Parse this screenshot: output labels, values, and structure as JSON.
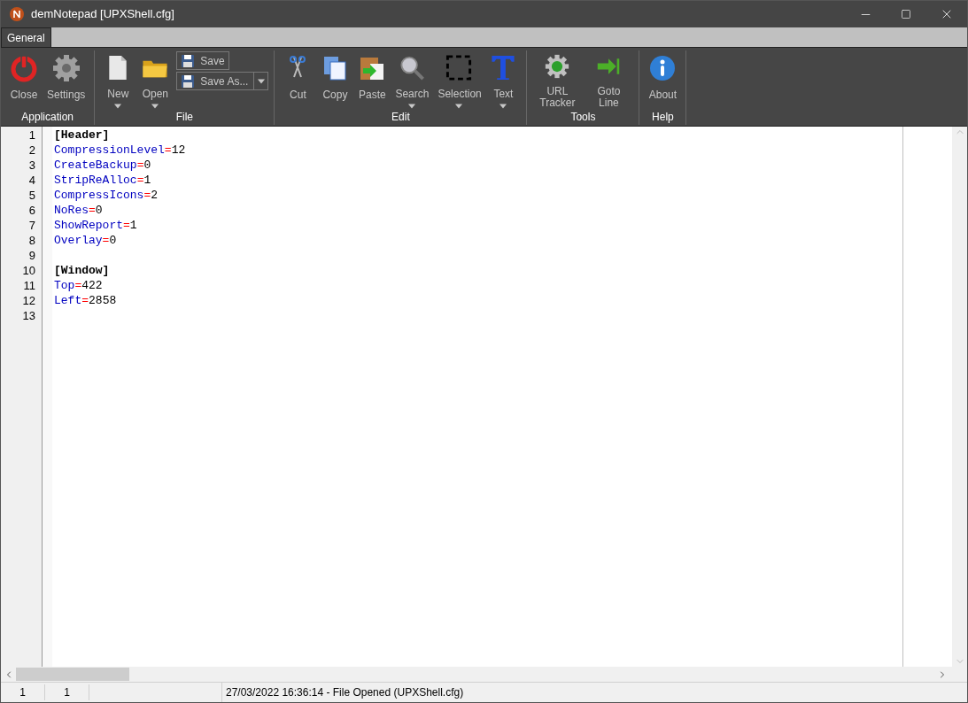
{
  "window": {
    "title": "demNotepad [UPXShell.cfg]"
  },
  "tabs": [
    {
      "label": "General",
      "selected": true
    }
  ],
  "ribbon_groups": [
    {
      "label": "Application",
      "buttons": [
        {
          "label": "Close",
          "kind": "large",
          "has_menu": false
        },
        {
          "label": "Settings",
          "kind": "large",
          "has_menu": false
        }
      ]
    },
    {
      "label": "File",
      "buttons": [
        {
          "label": "New",
          "kind": "large",
          "has_menu": true
        },
        {
          "label": "Open",
          "kind": "large",
          "has_menu": true
        },
        {
          "label": "Save",
          "kind": "small",
          "has_menu": false
        },
        {
          "label": "Save As...",
          "kind": "small",
          "has_menu": true
        }
      ]
    },
    {
      "label": "Edit",
      "buttons": [
        {
          "label": "Cut",
          "kind": "large",
          "has_menu": false
        },
        {
          "label": "Copy",
          "kind": "large",
          "has_menu": false
        },
        {
          "label": "Paste",
          "kind": "large",
          "has_menu": false
        },
        {
          "label": "Search",
          "kind": "large",
          "has_menu": true
        },
        {
          "label": "Selection",
          "kind": "large",
          "has_menu": true
        },
        {
          "label": "Text",
          "kind": "large",
          "has_menu": true
        }
      ]
    },
    {
      "label": "Tools",
      "buttons": [
        {
          "label": "URL Tracker",
          "kind": "large",
          "has_menu": false
        },
        {
          "label": "Goto Line",
          "kind": "large",
          "has_menu": false
        }
      ]
    },
    {
      "label": "Help",
      "buttons": [
        {
          "label": "About",
          "kind": "large",
          "has_menu": false
        }
      ]
    }
  ],
  "editor": {
    "lines": [
      {
        "number": "1",
        "segments": [
          {
            "kind": "section",
            "text": "[Header]"
          }
        ]
      },
      {
        "number": "2",
        "segments": [
          {
            "kind": "key",
            "text": "CompressionLevel"
          },
          {
            "kind": "equals",
            "text": "="
          },
          {
            "kind": "value",
            "text": "12"
          }
        ]
      },
      {
        "number": "3",
        "segments": [
          {
            "kind": "key",
            "text": "CreateBackup"
          },
          {
            "kind": "equals",
            "text": "="
          },
          {
            "kind": "value",
            "text": "0"
          }
        ]
      },
      {
        "number": "4",
        "segments": [
          {
            "kind": "key",
            "text": "StripReAlloc"
          },
          {
            "kind": "equals",
            "text": "="
          },
          {
            "kind": "value",
            "text": "1"
          }
        ]
      },
      {
        "number": "5",
        "segments": [
          {
            "kind": "key",
            "text": "CompressIcons"
          },
          {
            "kind": "equals",
            "text": "="
          },
          {
            "kind": "value",
            "text": "2"
          }
        ]
      },
      {
        "number": "6",
        "segments": [
          {
            "kind": "key",
            "text": "NoRes"
          },
          {
            "kind": "equals",
            "text": "="
          },
          {
            "kind": "value",
            "text": "0"
          }
        ]
      },
      {
        "number": "7",
        "segments": [
          {
            "kind": "key",
            "text": "ShowReport"
          },
          {
            "kind": "equals",
            "text": "="
          },
          {
            "kind": "value",
            "text": "1"
          }
        ]
      },
      {
        "number": "8",
        "segments": [
          {
            "kind": "key",
            "text": "Overlay"
          },
          {
            "kind": "equals",
            "text": "="
          },
          {
            "kind": "value",
            "text": "0"
          }
        ]
      },
      {
        "number": "9"
      },
      {
        "number": "10",
        "segments": [
          {
            "kind": "section",
            "text": "[Window]"
          }
        ]
      },
      {
        "number": "11",
        "segments": [
          {
            "kind": "key",
            "text": "Top"
          },
          {
            "kind": "equals",
            "text": "="
          },
          {
            "kind": "value",
            "text": "422"
          }
        ]
      },
      {
        "number": "12",
        "segments": [
          {
            "kind": "key",
            "text": "Left"
          },
          {
            "kind": "equals",
            "text": "="
          },
          {
            "kind": "value",
            "text": "2858"
          }
        ]
      },
      {
        "number": "13"
      }
    ]
  },
  "status_bar": {
    "line": "1",
    "column": "1",
    "message": "27/03/2022 16:36:14 - File Opened (UPXShell.cfg)"
  }
}
